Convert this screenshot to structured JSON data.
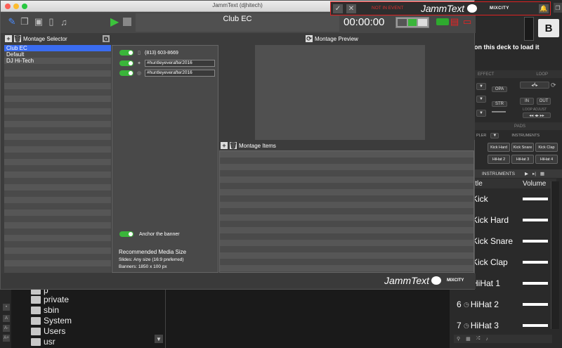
{
  "window": {
    "title": "JammText (djhitech)"
  },
  "toolbar": {
    "event_name": "Club EC",
    "timecode": "00:00:00"
  },
  "top_bar": {
    "status": "NOT IN EVENT",
    "logo": "JammText",
    "brand": "MIXCITY"
  },
  "selector": {
    "title": "Montage Selector",
    "items": [
      {
        "label": "Club EC",
        "active": true
      },
      {
        "label": "Default",
        "active": false
      },
      {
        "label": "DJ Hi-Tech",
        "active": false
      }
    ]
  },
  "details": {
    "phone": "(813) 603-8669",
    "twitter": "#huntleyeverafter2016",
    "instagram": "#huntleyeverafter2016",
    "anchor_label": "Anchor the banner",
    "media_title": "Recommended Media Size",
    "media_slides": "Slides: Any size (16:9 preferred)",
    "media_banners": "Banners: 1850 x 100 px"
  },
  "preview": {
    "title": "Montage Preview"
  },
  "items": {
    "title": "Montage Items"
  },
  "footer": {
    "logo": "JammText",
    "brand": "MIXCITY"
  },
  "dj": {
    "deck": "B",
    "message": "on this deck to load it",
    "effect": "EFFECT",
    "loop": "LOOP",
    "loop_value": "4",
    "opa": "OPA",
    "str": "STR",
    "in": "IN",
    "out": "OUT",
    "loop_adjust": "LOOP ADJUST",
    "pads": "PADS",
    "sampler": "PLER",
    "instruments_small": "INSTRUMENTS",
    "pads_row1": [
      "Kick Hard",
      "Kick Snare",
      "Kick Clap"
    ],
    "pads_row2": [
      "HiHat 2",
      "HiHat 3",
      "HiHat 4"
    ],
    "instruments_tab": "INSTRUMENTS",
    "col_title": "itle",
    "col_volume": "Volume",
    "rows": [
      {
        "num": "",
        "name": "Kick"
      },
      {
        "num": "",
        "name": "Kick Hard"
      },
      {
        "num": "",
        "name": "Kick Snare"
      },
      {
        "num": "",
        "name": "Kick Clap"
      },
      {
        "num": "",
        "name": "HiHat 1"
      },
      {
        "num": "6",
        "name": "HiHat 2"
      },
      {
        "num": "7",
        "name": "HiHat 3"
      }
    ]
  },
  "files": {
    "items": [
      "p",
      "private",
      "sbin",
      "System",
      "Users",
      "usr"
    ]
  },
  "colors": {
    "accent_green": "#3ab53a",
    "selection_blue": "#3a6cf0",
    "alert_red": "#e03030"
  }
}
